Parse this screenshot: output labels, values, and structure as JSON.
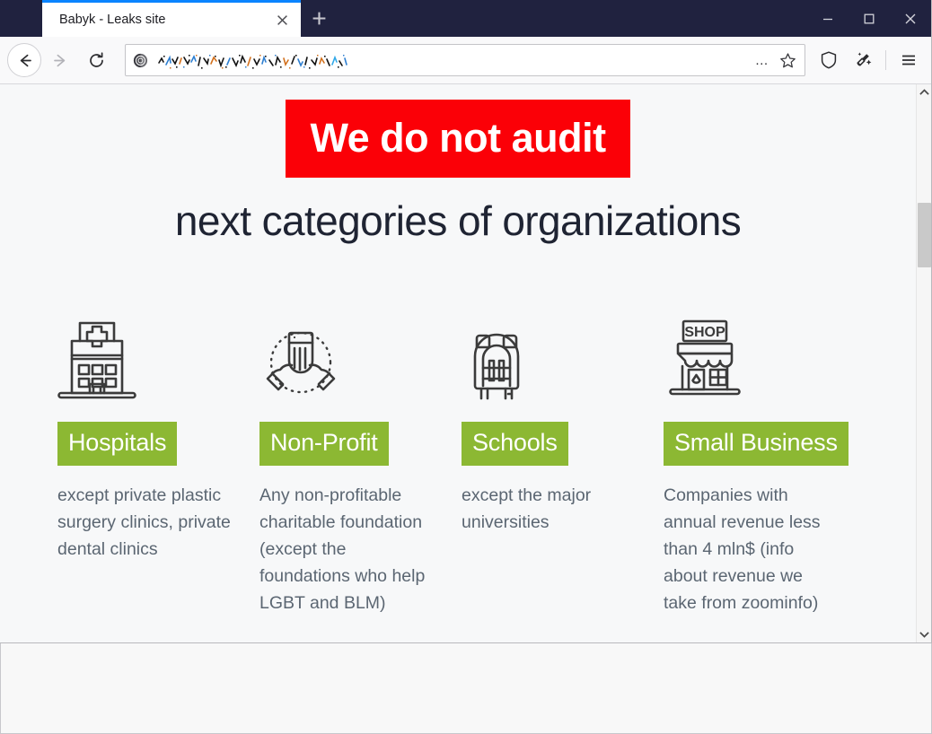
{
  "browser": {
    "name": "tor-browser",
    "tab": {
      "title": "Babyk - Leaks site",
      "close_label": "×"
    },
    "newtab_label": "+",
    "window_controls": {
      "minimize": "–",
      "maximize": "□",
      "close": "×"
    },
    "nav": {
      "back_label": "Back",
      "forward_label": "Forward",
      "reload_label": "Reload"
    },
    "urlbar": {
      "value": "",
      "placeholder": "",
      "redacted": true,
      "identity_icon": "onion-icon",
      "page_actions_label": "…",
      "bookmark_label": "Bookmark this page"
    },
    "toolbar": {
      "shield_label": "Tracking protection",
      "new_identity_label": "New identity",
      "menu_label": "Open application menu"
    },
    "scrollbar": {
      "up_label": "Scroll up",
      "down_label": "Scroll down",
      "thumb_label": "Vertical scroll thumb"
    }
  },
  "page": {
    "banner": {
      "text": "We do not audit",
      "bg_color": "#fb0007",
      "text_color": "#ffffff"
    },
    "subheading": "next categories of organizations",
    "chip_color": "#8cb833",
    "categories": [
      {
        "icon": "hospital-icon",
        "label": "Hospitals",
        "description": "except private plastic surgery clinics, private dental clinics"
      },
      {
        "icon": "helping-hands-icon",
        "label": "Non-Profit",
        "description": "Any non-profitable charitable foundation (except the foundations who help LGBT and BLM)"
      },
      {
        "icon": "backpack-icon",
        "label": "Schools",
        "description": "except the major universities"
      },
      {
        "icon": "shop-icon",
        "label": "Small Business",
        "description": "Companies with annual revenue less than 4 mln$ (info about revenue we take from zoominfo)"
      }
    ]
  }
}
